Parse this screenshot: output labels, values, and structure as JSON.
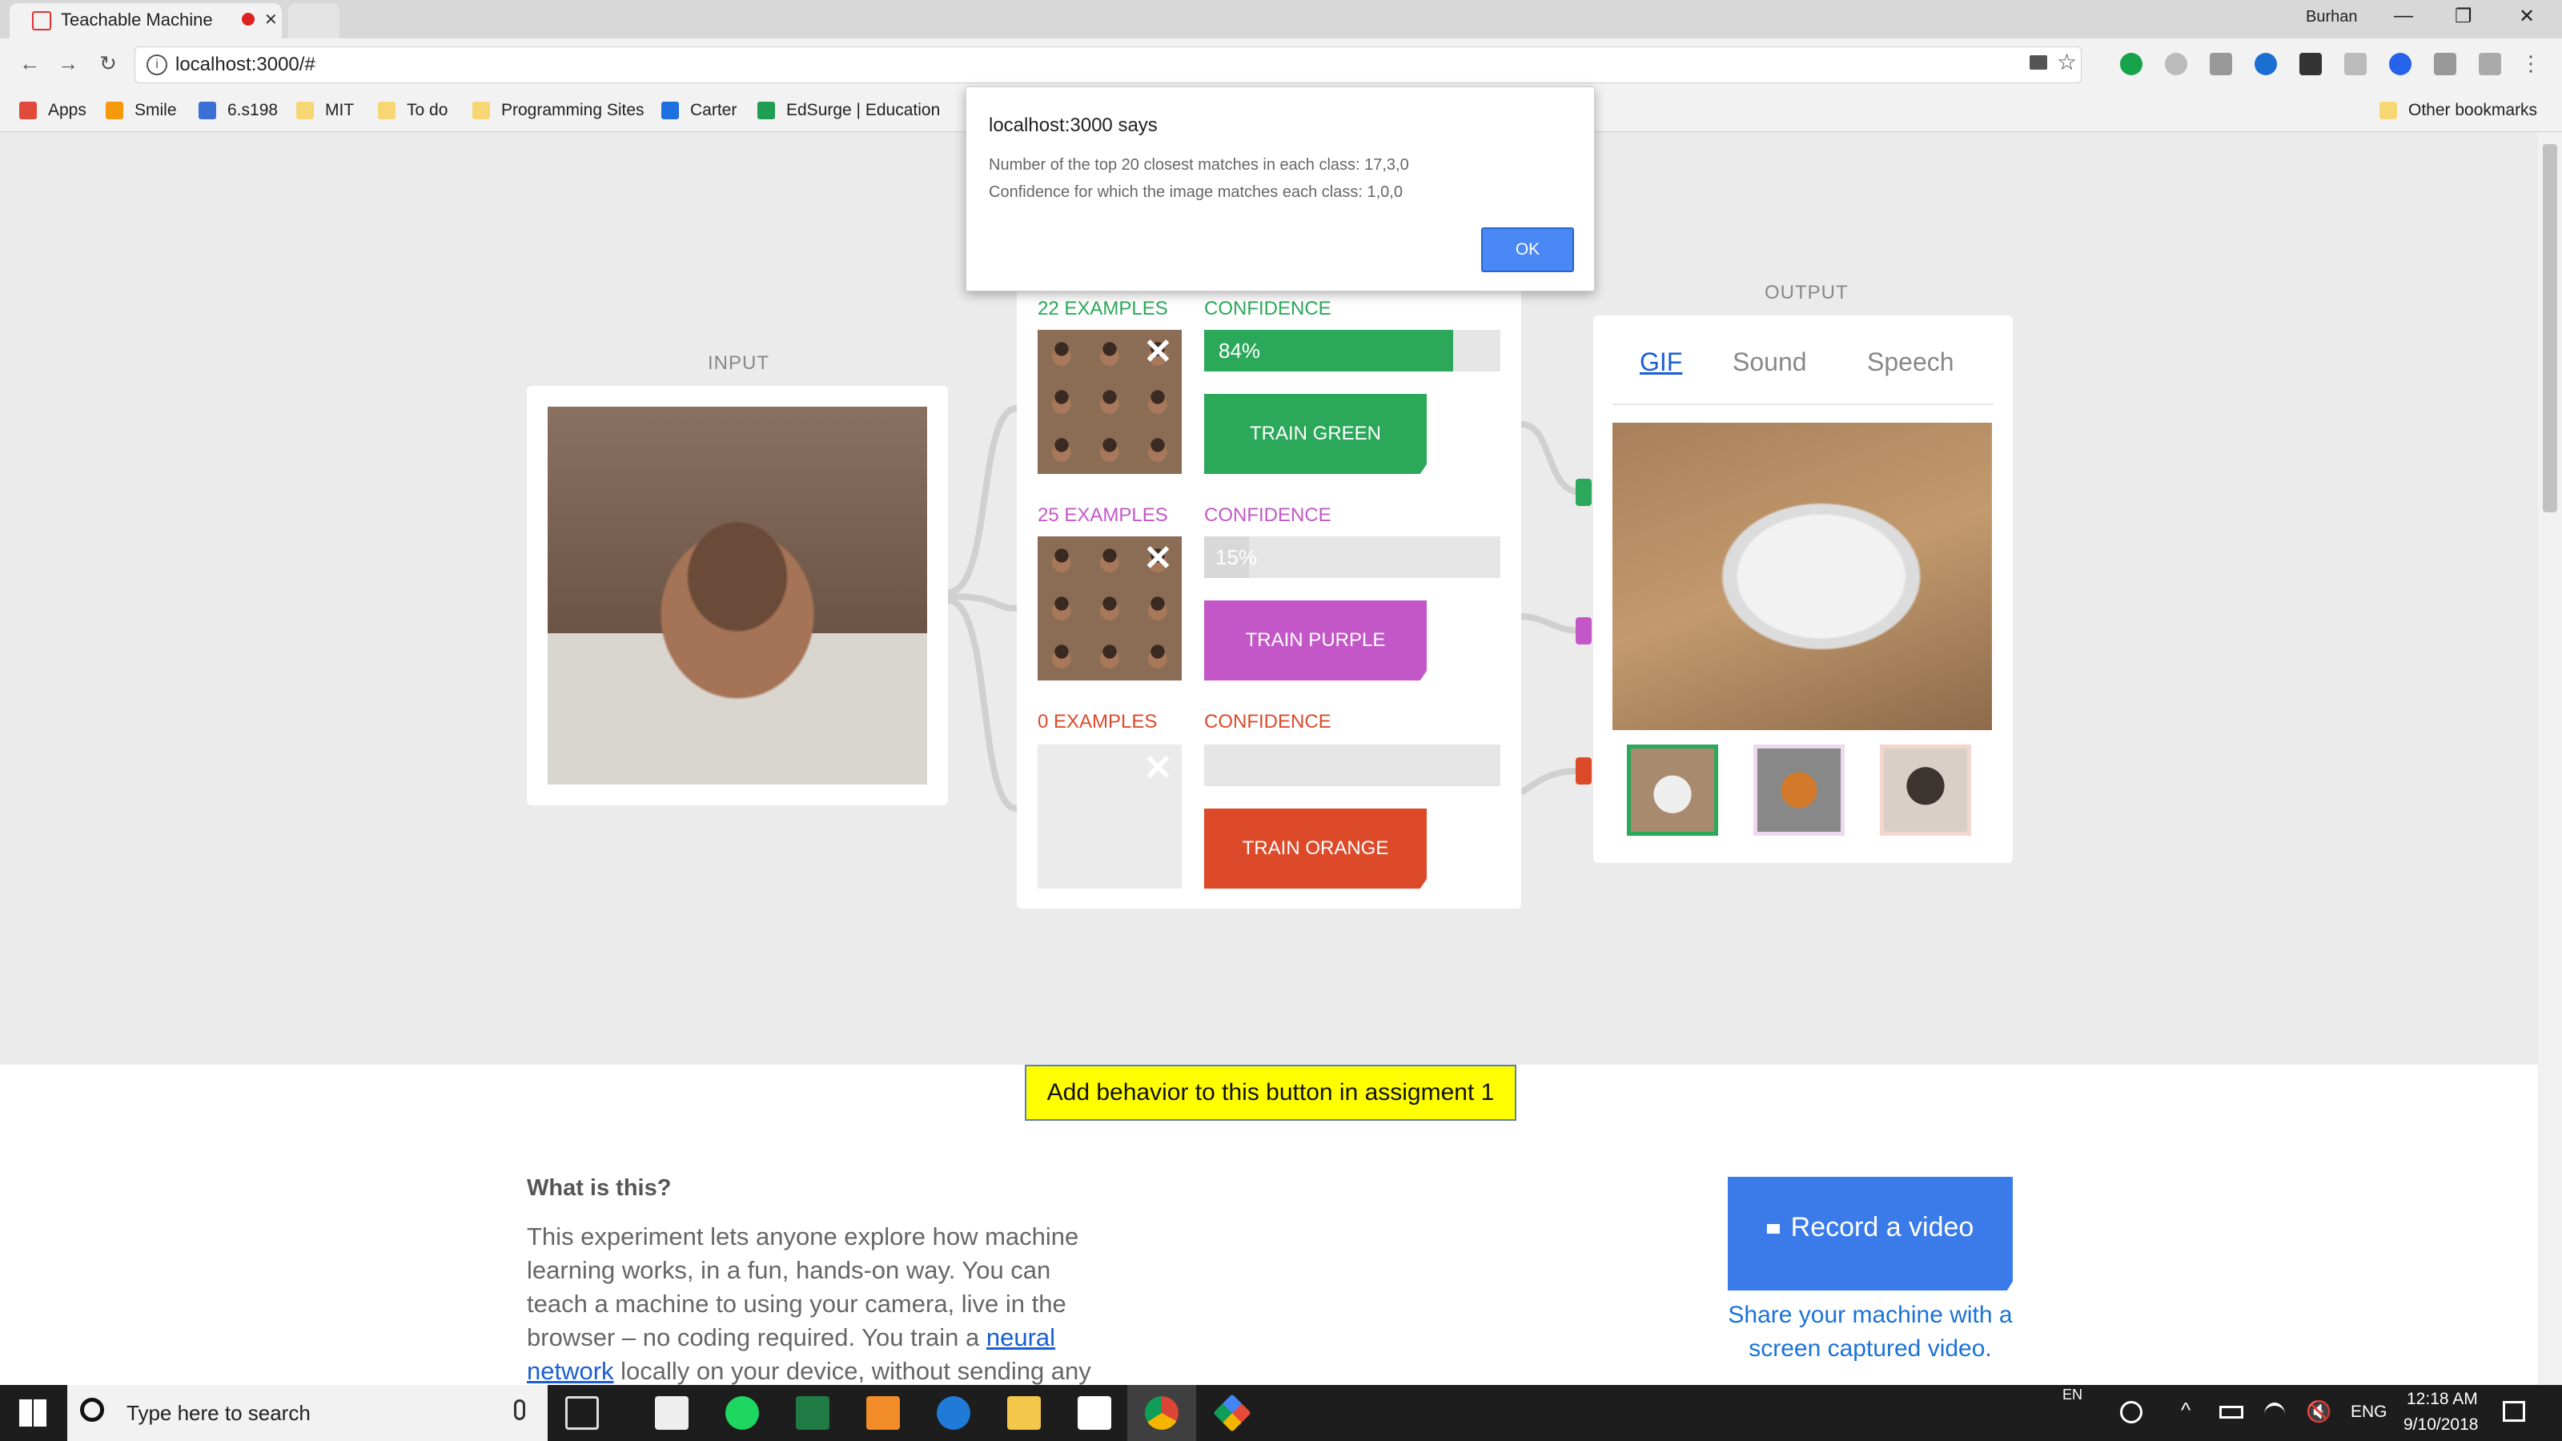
{
  "browser": {
    "tab_title": "Teachable Machine",
    "tab_close": "✕",
    "profile_name": "Burhan",
    "url": "localhost:3000/#",
    "window_controls": [
      "—",
      "❐",
      "✕"
    ]
  },
  "bookmarks": {
    "items": [
      "Apps",
      "Smile",
      "6.s198",
      "MIT",
      "To do",
      "Programming Sites",
      "Carter",
      "EdSurge | Education"
    ],
    "other": "Other bookmarks"
  },
  "dialog": {
    "title": "localhost:3000 says",
    "line1": "Number of the top 20 closest matches in each class: 17,3,0",
    "line2": "Confidence for which the image matches each class: 1,0,0",
    "ok_label": "OK"
  },
  "input": {
    "label": "INPUT"
  },
  "classes": [
    {
      "examples": "22 EXAMPLES",
      "confidence_label": "CONFIDENCE",
      "confidence_value": "84%",
      "confidence": 0.84,
      "train_label": "TRAIN GREEN",
      "color": "#2ca85a",
      "close": "✕"
    },
    {
      "examples": "25 EXAMPLES",
      "confidence_label": "CONFIDENCE",
      "confidence_value": "15%",
      "confidence": 0.15,
      "train_label": "TRAIN PURPLE",
      "color": "#c457c8",
      "close": "✕"
    },
    {
      "examples": "0 EXAMPLES",
      "confidence_label": "CONFIDENCE",
      "confidence_value": "",
      "confidence": 0,
      "train_label": "TRAIN ORANGE",
      "color": "#dd4a2a",
      "close": "✕"
    }
  ],
  "output": {
    "label": "OUTPUT",
    "tabs": [
      "GIF",
      "Sound",
      "Speech"
    ],
    "active_tab": "GIF"
  },
  "assignment_button": "Add behavior to this button in assigment 1",
  "about": {
    "heading": "What is this?",
    "text_before_link": "This experiment lets anyone explore how machine learning works, in a fun, hands-on way. You can teach a machine to using your camera, live in the browser – no coding required. You train a ",
    "link1": "neural",
    "link2": "network",
    "text_after_link": " locally on your device, without sending any"
  },
  "record": {
    "button_label": "Record a video",
    "caption": "Share your machine with a screen captured video."
  },
  "taskbar": {
    "search_placeholder": "Type here to search",
    "lang_top": "EN",
    "lang": "ENG",
    "time": "12:18 AM",
    "date": "9/10/2018"
  }
}
